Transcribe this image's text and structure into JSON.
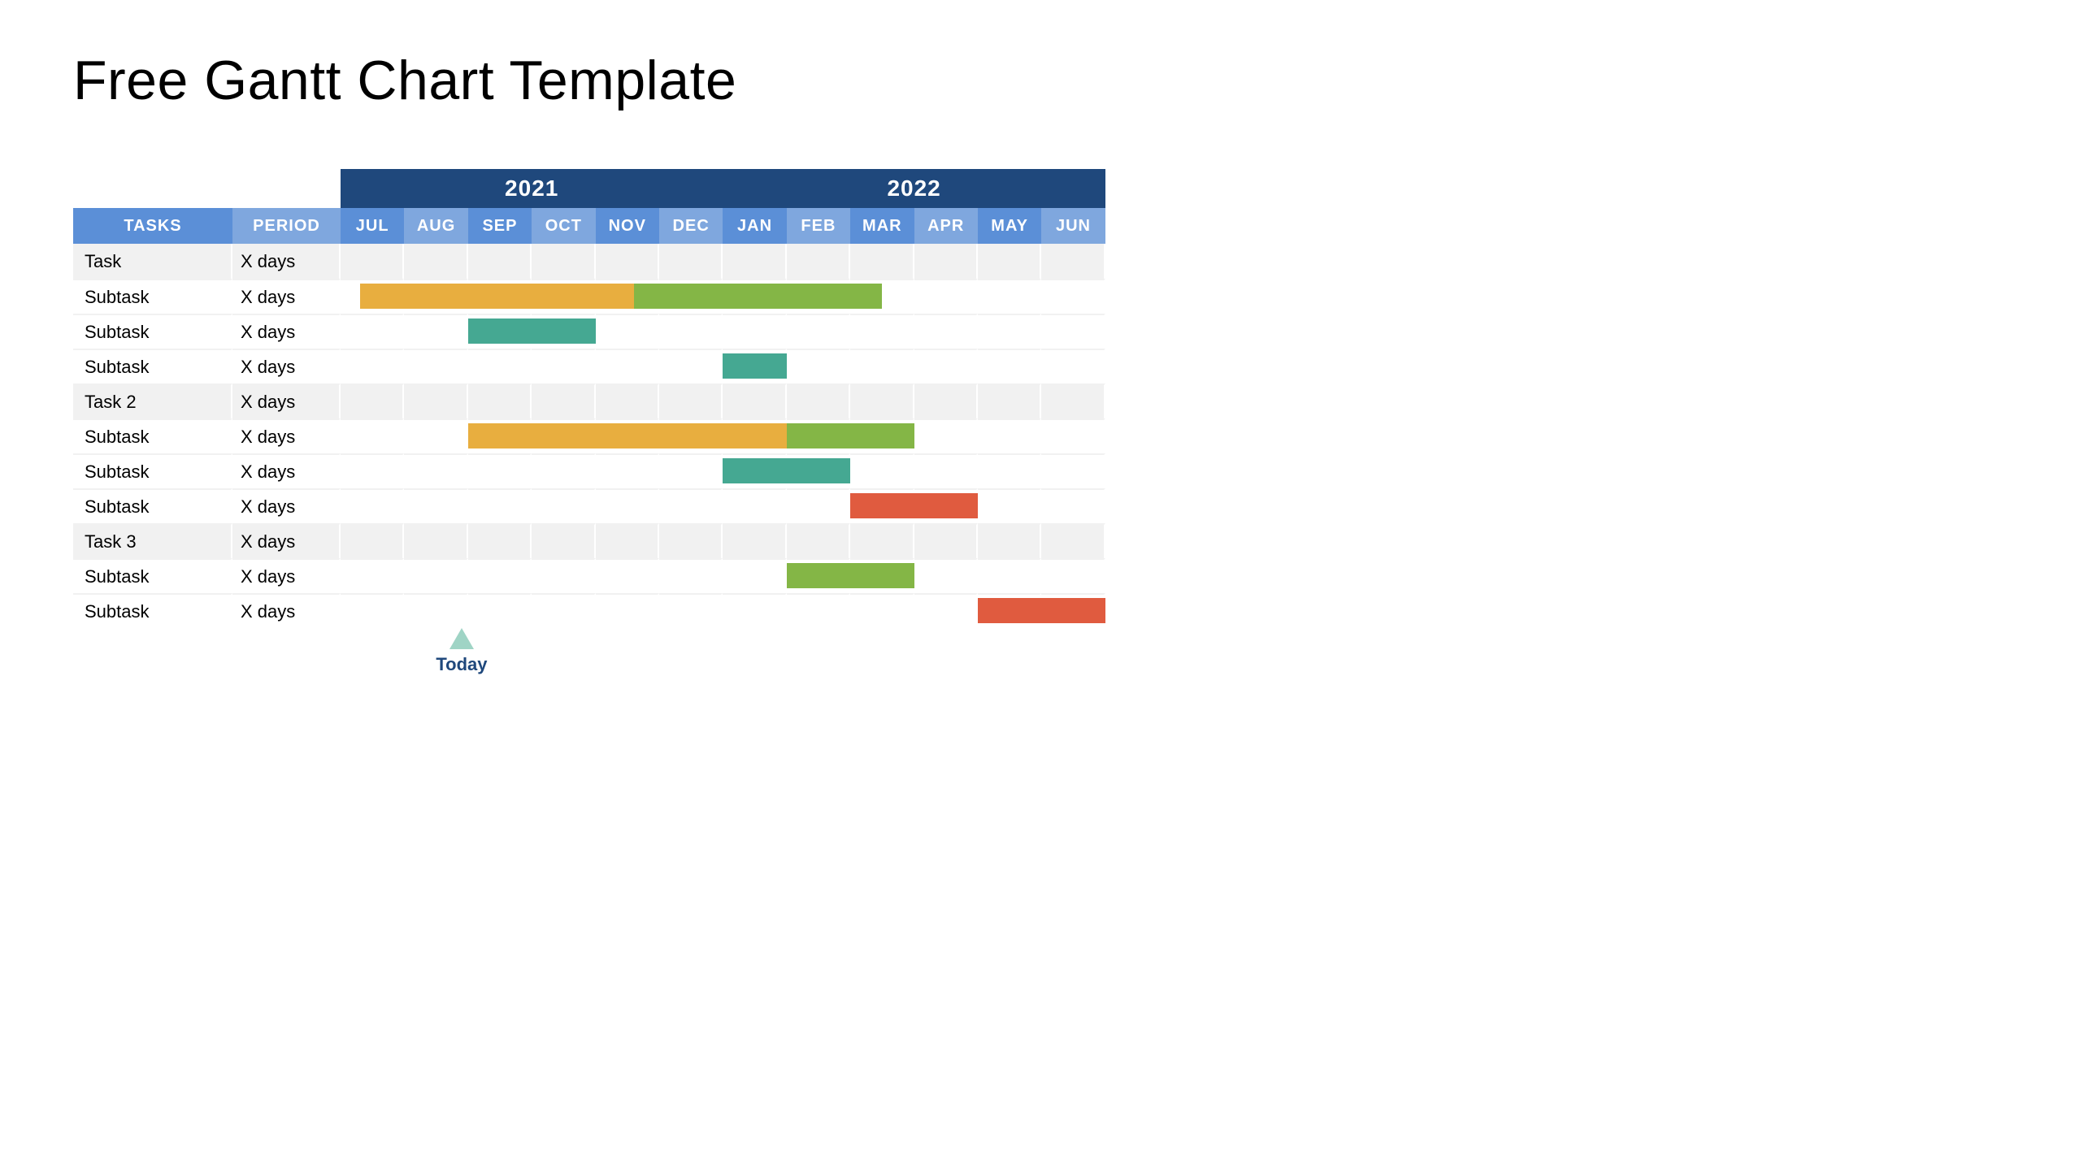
{
  "title": "Free Gantt Chart Template",
  "headers": {
    "tasks": "TASKS",
    "period": "PERIOD"
  },
  "years": [
    {
      "label": "2021",
      "span": 6
    },
    {
      "label": "2022",
      "span": 6
    }
  ],
  "months": [
    "JUL",
    "AUG",
    "SEP",
    "OCT",
    "NOV",
    "DEC",
    "JAN",
    "FEB",
    "MAR",
    "APR",
    "MAY",
    "JUN"
  ],
  "colors": {
    "orange": "#e8ae3f",
    "green": "#84b646",
    "teal": "#45a892",
    "red": "#e05b3f"
  },
  "today": {
    "label": "Today",
    "monthIndex": 1.9
  },
  "chart_data": {
    "type": "gantt",
    "time_axis": {
      "start": "2021-07",
      "end": "2022-06",
      "labels": [
        "JUL",
        "AUG",
        "SEP",
        "OCT",
        "NOV",
        "DEC",
        "JAN",
        "FEB",
        "MAR",
        "APR",
        "MAY",
        "JUN"
      ]
    },
    "rows": [
      {
        "name": "Task",
        "period": "X days",
        "group": true,
        "bars": []
      },
      {
        "name": "Subtask",
        "period": "X days",
        "group": false,
        "bars": [
          {
            "start": 0.3,
            "end": 4.6,
            "color": "orange"
          },
          {
            "start": 4.6,
            "end": 8.5,
            "color": "green"
          }
        ]
      },
      {
        "name": "Subtask",
        "period": "X days",
        "group": false,
        "bars": [
          {
            "start": 2.0,
            "end": 4.0,
            "color": "teal"
          }
        ]
      },
      {
        "name": "Subtask",
        "period": "X days",
        "group": false,
        "bars": [
          {
            "start": 6.0,
            "end": 7.0,
            "color": "teal"
          }
        ]
      },
      {
        "name": "Task 2",
        "period": "X days",
        "group": true,
        "bars": []
      },
      {
        "name": "Subtask",
        "period": "X days",
        "group": false,
        "bars": [
          {
            "start": 2.0,
            "end": 7.0,
            "color": "orange"
          },
          {
            "start": 7.0,
            "end": 9.0,
            "color": "green"
          }
        ]
      },
      {
        "name": "Subtask",
        "period": "X days",
        "group": false,
        "bars": [
          {
            "start": 6.0,
            "end": 8.0,
            "color": "teal"
          }
        ]
      },
      {
        "name": "Subtask",
        "period": "X days",
        "group": false,
        "bars": [
          {
            "start": 8.0,
            "end": 10.0,
            "color": "red"
          }
        ]
      },
      {
        "name": "Task 3",
        "period": "X days",
        "group": true,
        "bars": []
      },
      {
        "name": "Subtask",
        "period": "X days",
        "group": false,
        "bars": [
          {
            "start": 7.0,
            "end": 9.0,
            "color": "green"
          }
        ]
      },
      {
        "name": "Subtask",
        "period": "X days",
        "group": false,
        "bars": [
          {
            "start": 10.0,
            "end": 12.0,
            "color": "red"
          }
        ]
      }
    ]
  }
}
